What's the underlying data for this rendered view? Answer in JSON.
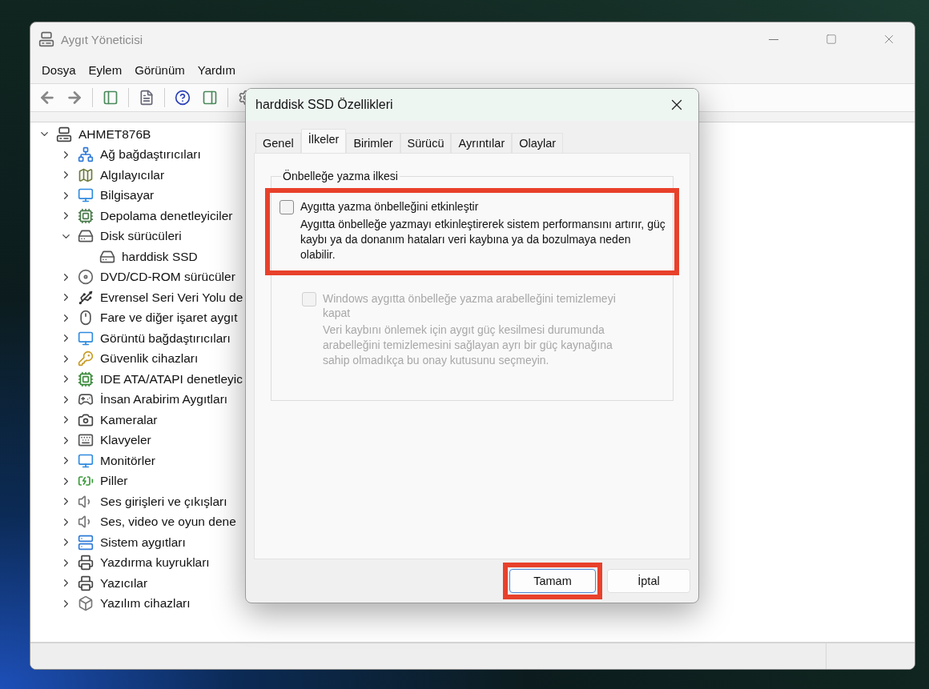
{
  "window": {
    "title": "Aygıt Yöneticisi"
  },
  "menu": [
    "Dosya",
    "Eylem",
    "Görünüm",
    "Yardım"
  ],
  "tree": {
    "label": "AHMET876B",
    "expanded": true,
    "children": [
      {
        "label": "Ağ bağdaştırıcıları",
        "expanded": false
      },
      {
        "label": "Algılayıcılar",
        "expanded": false
      },
      {
        "label": "Bilgisayar",
        "expanded": false
      },
      {
        "label": "Depolama denetleyiciler",
        "expanded": false
      },
      {
        "label": "Disk sürücüleri",
        "expanded": true,
        "children": [
          {
            "label": "harddisk SSD"
          }
        ]
      },
      {
        "label": "DVD/CD-ROM sürücüler",
        "expanded": false
      },
      {
        "label": "Evrensel Seri Veri Yolu de",
        "expanded": false
      },
      {
        "label": "Fare ve diğer işaret aygıt",
        "expanded": false
      },
      {
        "label": "Görüntü bağdaştırıcıları",
        "expanded": false
      },
      {
        "label": "Güvenlik cihazları",
        "expanded": false
      },
      {
        "label": "IDE ATA/ATAPI denetleyic",
        "expanded": false
      },
      {
        "label": "İnsan Arabirim Aygıtları",
        "expanded": false
      },
      {
        "label": "Kameralar",
        "expanded": false
      },
      {
        "label": "Klavyeler",
        "expanded": false
      },
      {
        "label": "Monitörler",
        "expanded": false
      },
      {
        "label": "Piller",
        "expanded": false
      },
      {
        "label": "Ses girişleri ve çıkışları",
        "expanded": false
      },
      {
        "label": "Ses, video ve oyun dene",
        "expanded": false
      },
      {
        "label": "Sistem aygıtları",
        "expanded": false
      },
      {
        "label": "Yazdırma kuyrukları",
        "expanded": false
      },
      {
        "label": "Yazıcılar",
        "expanded": false
      },
      {
        "label": "Yazılım cihazları",
        "expanded": false
      }
    ]
  },
  "dialog": {
    "title": "harddisk SSD Özellikleri",
    "tabs": [
      {
        "label": "Genel",
        "selected": false
      },
      {
        "label": "İlkeler",
        "selected": true
      },
      {
        "label": "Birimler",
        "selected": false
      },
      {
        "label": "Sürücü",
        "selected": false
      },
      {
        "label": "Ayrıntılar",
        "selected": false
      },
      {
        "label": "Olaylar",
        "selected": false
      }
    ],
    "group": {
      "title": "Önbelleğe yazma ilkesi",
      "options": [
        {
          "label": "Aygıtta yazma önbelleğini etkinleştir",
          "description": "Aygıtta önbelleğe yazmayı etkinleştirerek sistem performansını artırır, güç kaybı ya da donanım hataları veri kaybına ya da bozulmaya neden olabilir.",
          "checked": false,
          "disabled": false,
          "highlighted": true
        },
        {
          "label": "Windows aygıtta önbelleğe yazma arabelleğini temizlemeyi kapat",
          "description": "Veri kaybını önlemek için aygıt güç kesilmesi durumunda arabelleğini temizlemesini sağlayan ayrı bir güç kaynağına sahip olmadıkça bu onay kutusunu seçmeyin.",
          "checked": false,
          "disabled": true,
          "highlighted": false
        }
      ]
    },
    "buttons": [
      {
        "label": "Tamam",
        "default": true,
        "highlighted": true
      },
      {
        "label": "İptal",
        "default": false,
        "highlighted": false
      }
    ]
  }
}
